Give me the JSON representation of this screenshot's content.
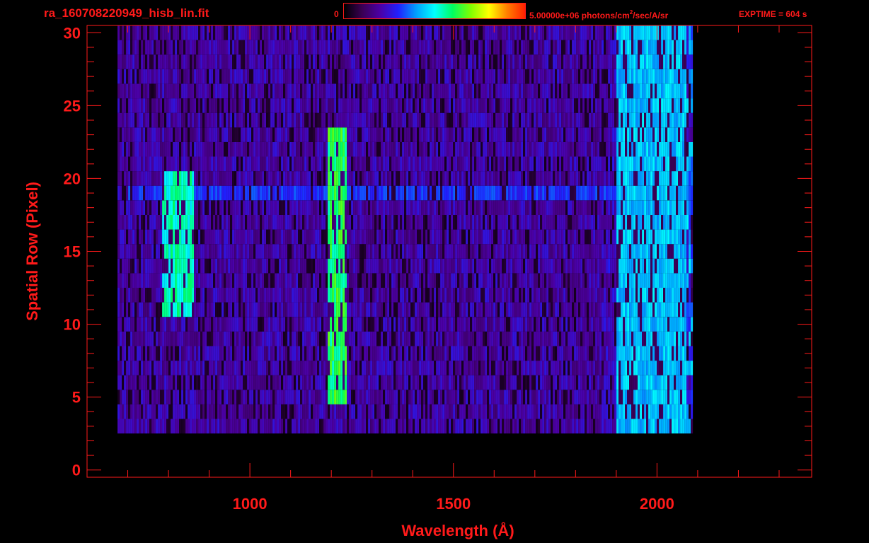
{
  "header": {
    "file_title": "ra_160708220949_hisb_lin.fit",
    "colorbar_min_label": "0",
    "colorbar_max_value": "5.00000e+06 photons/cm",
    "colorbar_max_exponent": "2",
    "colorbar_max_units_tail": "/sec/A/sr",
    "exptime_label": "EXPTIME = 604 s"
  },
  "colors": {
    "axis_red": "#ff1a1a",
    "background": "#000000",
    "colormap": [
      "#000000",
      "#3a0052",
      "#4b00a6",
      "#2020ff",
      "#00a0ff",
      "#00ffff",
      "#00ff60",
      "#80ff00",
      "#ffff00",
      "#ff8000",
      "#ff2000"
    ]
  },
  "chart_data": {
    "type": "heatmap",
    "title": "ra_160708220949_hisb_lin.fit",
    "xlabel": "Wavelength (Å)",
    "ylabel": "Spatial Row (Pixel)",
    "xlim": [
      600,
      2380
    ],
    "ylim": [
      -0.5,
      30.5
    ],
    "x_ticks": [
      1000,
      1500,
      2000
    ],
    "y_ticks": [
      0,
      5,
      10,
      15,
      20,
      25,
      30
    ],
    "x_minor_step": 100,
    "y_minor_step": 1,
    "colorbar": {
      "min": 0,
      "max": 5000000,
      "units": "photons/cm^2/sec/A/sr",
      "scale": "linear"
    },
    "exptime_s": 604,
    "data_extent": {
      "x_start": 675,
      "x_end": 2085,
      "row_min": 3,
      "row_max": 30
    },
    "features": [
      {
        "x_start": 1190,
        "x_end": 1235,
        "row_min": 5,
        "row_max": 23,
        "level": 0.62
      },
      {
        "x_start": 780,
        "x_end": 860,
        "row_min": 11,
        "row_max": 20,
        "level": 0.55
      },
      {
        "x_start": 700,
        "x_end": 2070,
        "row_min": 19,
        "row_max": 19,
        "level": 0.32
      },
      {
        "x_start": 1900,
        "x_end": 2070,
        "row_min": 3,
        "row_max": 30,
        "level": 0.45
      }
    ]
  },
  "axes": {
    "x_label": "Wavelength (Å)",
    "y_label": "Spatial Row (Pixel)",
    "x_tick_labels": [
      "1000",
      "1500",
      "2000"
    ],
    "y_tick_labels": [
      "0",
      "5",
      "10",
      "15",
      "20",
      "25",
      "30"
    ]
  }
}
